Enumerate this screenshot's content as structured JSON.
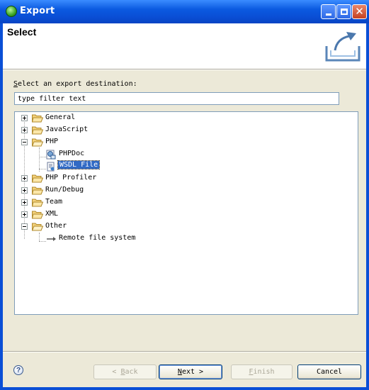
{
  "window": {
    "title": "Export"
  },
  "header": {
    "title": "Select"
  },
  "destination": {
    "label_prefix": "",
    "label_mnemonic": "S",
    "label_rest": "elect an export destination:"
  },
  "filter": {
    "value": "type filter text"
  },
  "tree": {
    "items": [
      {
        "label": "General",
        "expanded": false
      },
      {
        "label": "JavaScript",
        "expanded": false
      },
      {
        "label": "PHP",
        "expanded": true,
        "children": [
          {
            "label": "PHPDoc",
            "icon": "phpdoc-icon"
          },
          {
            "label": "WSDL File",
            "icon": "wsdl-file-icon",
            "selected": true
          }
        ]
      },
      {
        "label": "PHP Profiler",
        "expanded": false
      },
      {
        "label": "Run/Debug",
        "expanded": false
      },
      {
        "label": "Team",
        "expanded": false
      },
      {
        "label": "XML",
        "expanded": false
      },
      {
        "label": "Other",
        "expanded": true,
        "children": [
          {
            "label": "Remote file system",
            "icon": "remote-file-system-icon"
          }
        ]
      }
    ]
  },
  "buttons": {
    "back": {
      "prefix": "< ",
      "mnemonic": "B",
      "rest": "ack",
      "enabled": false
    },
    "next": {
      "prefix": "",
      "mnemonic": "N",
      "rest": "ext >",
      "enabled": true
    },
    "finish": {
      "prefix": "",
      "mnemonic": "F",
      "rest": "inish",
      "enabled": false
    },
    "cancel": {
      "label": "Cancel",
      "enabled": true
    }
  },
  "colors": {
    "titlebar": "#0a4fd6",
    "selection": "#316ac5",
    "dialog_bg": "#ece9d8"
  }
}
